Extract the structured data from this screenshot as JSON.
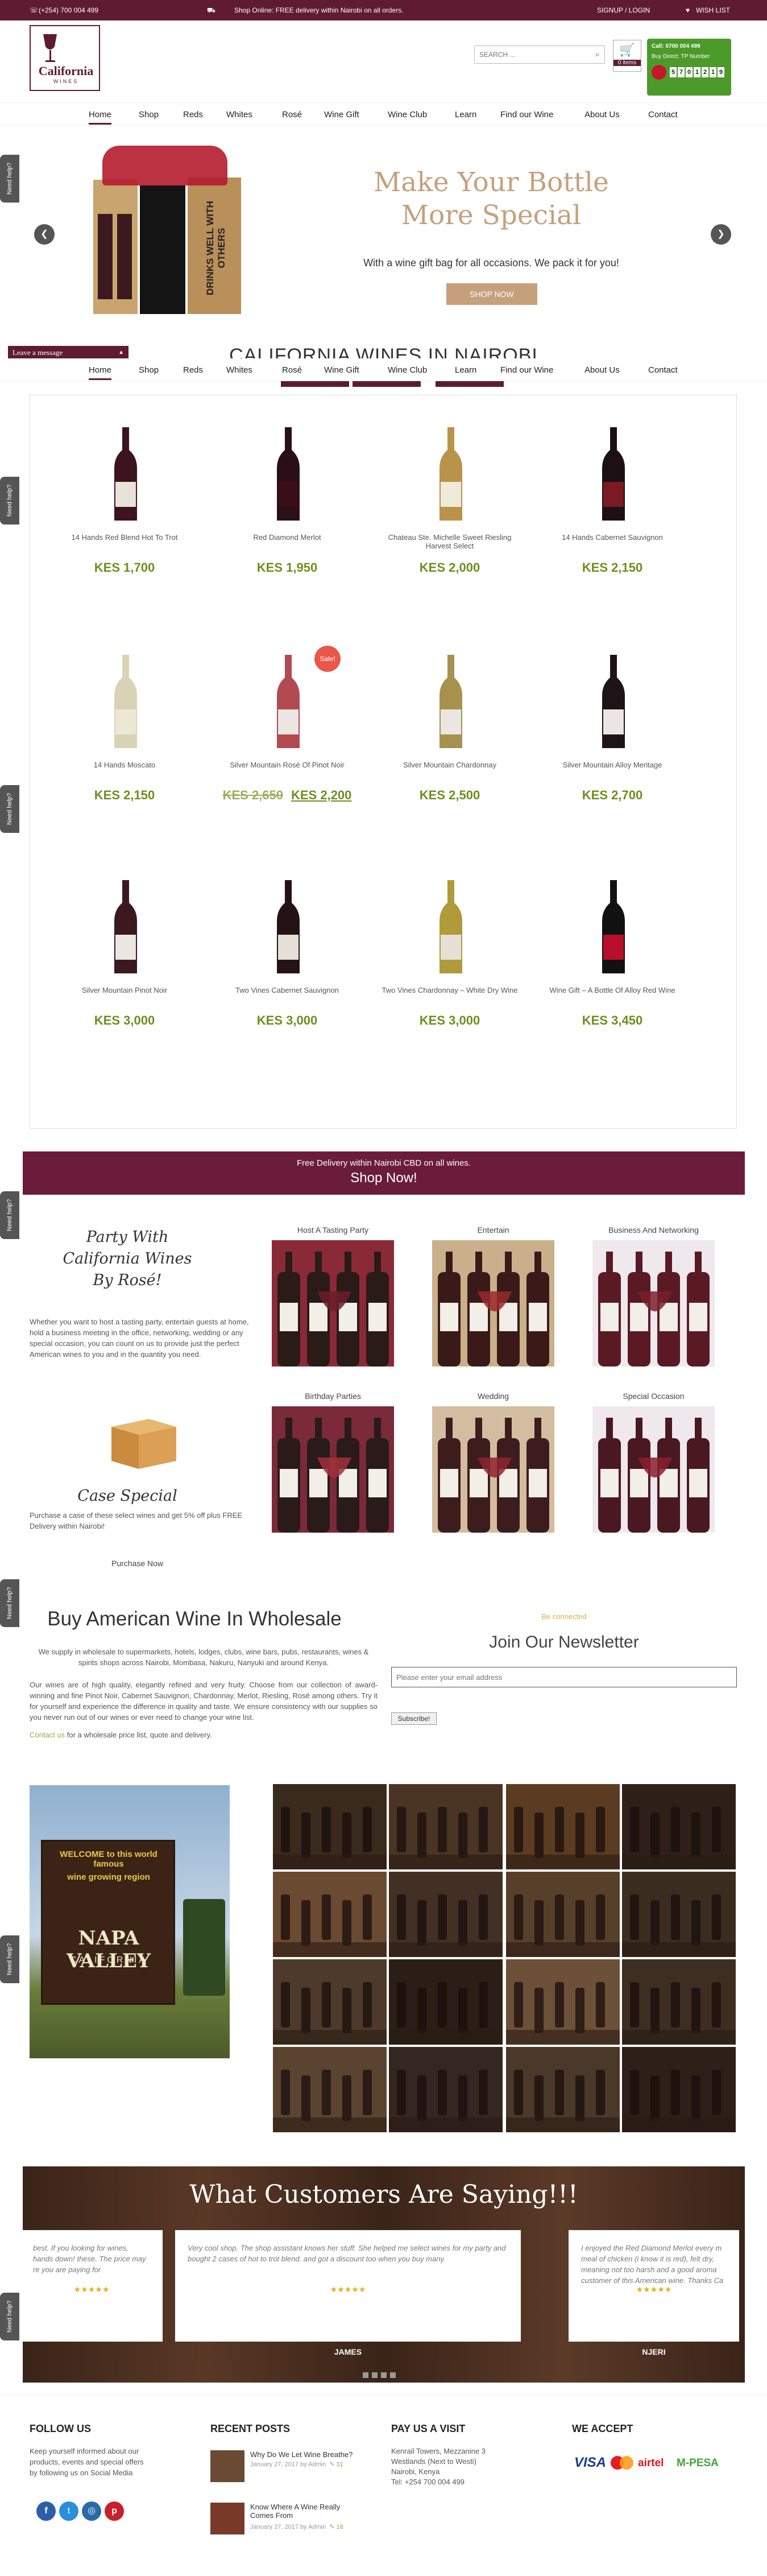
{
  "topbar": {
    "phone": "(+254) 700 004 499",
    "promo": "Shop Online: FREE delivery within Nairobi on all orders.",
    "signup": "SIGNUP / LOGIN",
    "wishlist": "WISH LIST"
  },
  "header": {
    "logo_text": "California",
    "logo_sub": "WINES",
    "search_placeholder": "SEARCH ...",
    "cart_label": "0 items",
    "badge_line1": "Call: 0700 004 499",
    "badge_line2": "Buy Direct: TP Number",
    "badge_digits": [
      "5",
      "7",
      "0",
      "1",
      "2",
      "1",
      "9"
    ]
  },
  "nav": [
    "Home",
    "Shop",
    "Reds",
    "Whites",
    "Rosé",
    "Wine Gift",
    "Wine Club",
    "Learn",
    "Find our Wine",
    "About Us",
    "Contact"
  ],
  "slider": {
    "title_line1": "Make Your Bottle",
    "title_line2": "More Special",
    "subtitle": "With a wine gift bag for all occasions. We pack it for you!",
    "button": "SHOP NOW",
    "bag_text": "DRINKS WELL WITH OTHERS"
  },
  "leave_message": "Leave a message",
  "section_title": "CALIFORNIA WINES IN NAIROBI",
  "help_tab": "Need help?",
  "products": [
    {
      "name": "14 Hands Red Blend Hot To Trot",
      "price": "KES 1,700",
      "color": "#3b1420",
      "label": "#e8e2d8"
    },
    {
      "name": "Red Diamond Merlot",
      "price": "KES 1,950",
      "color": "#2a0f18",
      "label": "#3a0e16"
    },
    {
      "name": "Chateau Ste. Michelle Sweet Riesling Harvest Select",
      "price": "KES 2,000",
      "color": "#b9934a",
      "label": "#f0ead8"
    },
    {
      "name": "14 Hands Cabernet Sauvignon",
      "price": "KES 2,150",
      "color": "#1c1014",
      "label": "#7a1a22"
    },
    {
      "name": "14 Hands Moscato",
      "price": "KES 2,150",
      "color": "#d9d3b6",
      "label": "#ede7d5"
    },
    {
      "name": "Silver Mountain Rosé Of Pinot Noir",
      "price": "KES 2,200",
      "old_price": "KES 2,650",
      "sale": "Sale!",
      "color": "#b24a52",
      "label": "#ebe6e1"
    },
    {
      "name": "Silver Mountain Chardonnay",
      "price": "KES 2,500",
      "color": "#a6924e",
      "label": "#ebe6e1"
    },
    {
      "name": "Silver Mountain Alloy Meritage",
      "price": "KES 2,700",
      "color": "#1e1418",
      "label": "#ebe6e1"
    },
    {
      "name": "Silver Mountain Pinot Noir",
      "price": "KES 3,000",
      "color": "#3c1820",
      "label": "#ebe6e1"
    },
    {
      "name": "Two Vines Cabernet Sauvignon",
      "price": "KES 3,000",
      "color": "#241216",
      "label": "#e6e0d6"
    },
    {
      "name": "Two Vines Chardonnay – White Dry Wine",
      "price": "KES 3,000",
      "color": "#b09a3a",
      "label": "#e6e0d6"
    },
    {
      "name": "Wine Gift – A Bottle Of Alloy Red Wine",
      "price": "KES 3,450",
      "color": "#111",
      "label": "#b8102a"
    }
  ],
  "delivery_banner": {
    "line1": "Free Delivery within Nairobi CBD on all wines.",
    "line2": "Shop Now!"
  },
  "party": {
    "title_line1": "Party With",
    "title_line2": "California Wines",
    "title_line3": "By Rosé!",
    "text": "Whether you want to host a tasting party, entertain guests at home, hold a business meeting in the office, networking, wedding or any special occasion, you can count on us to provide just the perfect American wines to you and in the quantity you need."
  },
  "case": {
    "title": "Case Special",
    "text": "Purchase a case of these select wines and get 5% off plus FREE Delivery within Nairobi!",
    "link": "Purchase Now"
  },
  "occasions": [
    "Host A Tasting Party",
    "Entertain",
    "Business And Networking",
    "Birthday Parties",
    "Wedding",
    "Special Occasion"
  ],
  "wholesale": {
    "title": "Buy American Wine In Wholesale",
    "p1": "We supply in wholesale to supermarkets, hotels, lodges, clubs, wine bars, pubs, restaurants, wines & spirits shops across Nairobi, Mombasa, Nakuru, Nanyuki and around Kenya.",
    "p2": "Our wines are of high quality, elegantly refined and very fruity. Choose from our collection of award-winning and fine Pinot Noir, Cabernet Sauvignon, Chardonnay, Merlot, Riesling, Rosé among others. Try it for yourself and experience the difference in quality and taste. We ensure consistency with our supplies so you never run out of our wines or ever need to change your wine list.",
    "p3_a": "Contact us",
    "p3_b": "for a wholesale price list, quote and delivery."
  },
  "newsletter": {
    "note": "Be connected",
    "title": "Join Our Newsletter",
    "placeholder": "Please enter your email address",
    "button": "Subscribe!"
  },
  "napa": {
    "line1": "WELCOME to this world famous",
    "line2": "wine growing region",
    "line3": "NAPA VALLEY",
    "line4": "CALIFORNIA"
  },
  "gallery_colors": [
    "#3a2a1c",
    "#4a3424",
    "#5b3c22",
    "#2e2018",
    "#6a4a30",
    "#423024",
    "#57402a",
    "#3b2c20",
    "#4e3a2a",
    "#2a1e16",
    "#6c5038",
    "#3e2e22",
    "#5a4430",
    "#342620",
    "#4a3828",
    "#2c2018"
  ],
  "testimonials": {
    "title": "What Customers Are Saying!!!",
    "items": [
      {
        "text": "best. If you looking for wines, hands down! these. The price may re you are paying for",
        "name": ""
      },
      {
        "text": "Very cool shop. The shop assistant knows her stuff. She helped me select wines for my party and bought 2 cases of hot to trot blend. and got a discount too when you buy many.",
        "name": "JAMES"
      },
      {
        "text": "I enjoyed the Red Diamond Merlot every m meal of chicken (i know it is red), felt dry, meaning not too harsh and a good aroma customer of this American wine. Thanks Ca",
        "name": "NJERI"
      }
    ]
  },
  "footer": {
    "follow": {
      "title": "FOLLOW US",
      "text": "Keep yourself informed about our products, events and special offers by following us on Social Media"
    },
    "posts": {
      "title": "RECENT POSTS",
      "items": [
        {
          "title": "Why Do We Let Wine Breathe?",
          "meta": "January 27, 2017 by Admin",
          "count": "31"
        },
        {
          "title": "Know Where A Wine Really Comes From",
          "meta": "January 27, 2017 by Admin",
          "count": "16"
        }
      ]
    },
    "visit": {
      "title": "PAY US A VISIT",
      "lines": [
        "Kenrail Towers, Mezzanine 3",
        "Westlands (Next to Westi)",
        "Nairobi, Kenya",
        "Tel: +254 700 004 499"
      ]
    },
    "accept": {
      "title": "WE ACCEPT",
      "logos": [
        "VISA",
        "MasterCard",
        "airtel",
        "M-PESA"
      ]
    }
  }
}
